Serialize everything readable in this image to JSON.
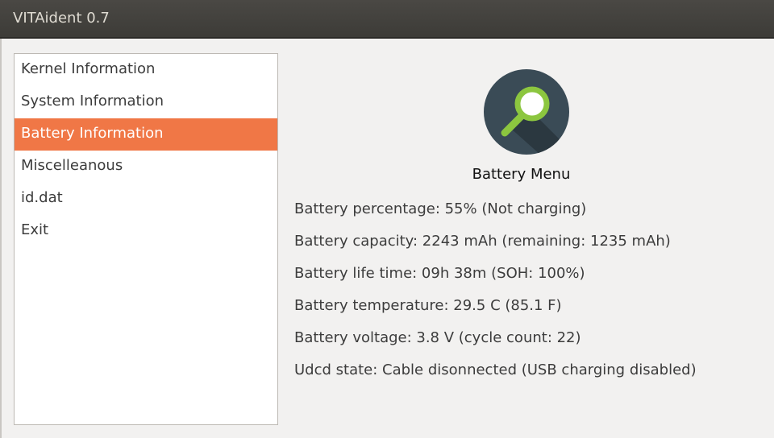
{
  "window": {
    "title": "VITAident 0.7"
  },
  "sidebar": {
    "items": [
      {
        "label": "Kernel Information"
      },
      {
        "label": "System Information"
      },
      {
        "label": "Battery Information"
      },
      {
        "label": "Miscelleanous"
      },
      {
        "label": "id.dat"
      },
      {
        "label": "Exit"
      }
    ],
    "selected_index": 2
  },
  "main": {
    "icon": "magnifier-icon",
    "title": "Battery Menu",
    "lines": [
      "Battery percentage: 55% (Not charging)",
      "Battery capacity: 2243 mAh (remaining: 1235 mAh)",
      "Battery life time: 09h 38m (SOH: 100%)",
      "Battery temperature: 29.5 C (85.1 F)",
      "Battery voltage: 3.8 V (cycle count: 22)",
      "Udcd state: Cable disonnected (USB charging disabled)"
    ]
  },
  "colors": {
    "accent": "#f07746",
    "titlebar": "#3c3b37",
    "icon_bg": "#3a4b56",
    "icon_lens": "#8cc63f"
  }
}
